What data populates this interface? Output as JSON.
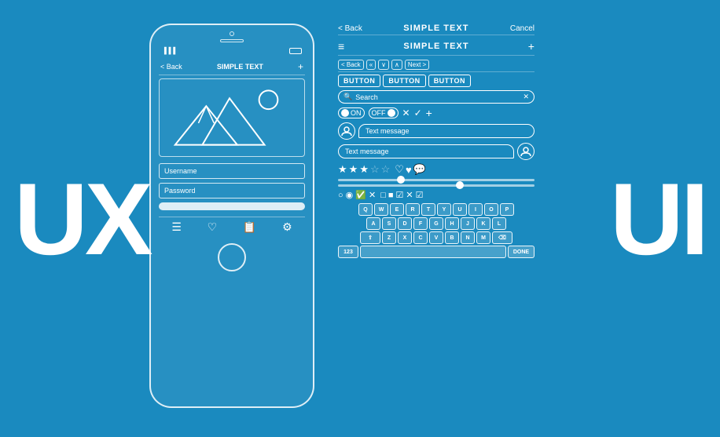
{
  "background": "#1a8abf",
  "ux_label": "UX",
  "ui_label": "UI",
  "phone": {
    "back_label": "< Back",
    "title": "SIMPLE TEXT",
    "plus_label": "+",
    "username_placeholder": "Username",
    "password_placeholder": "Password"
  },
  "ui_panel": {
    "row1": {
      "back": "< Back",
      "title": "SIMPLE TEXT",
      "cancel": "Cancel"
    },
    "row2": {
      "hamburger": "≡",
      "title": "SIMPLE TEXT",
      "plus": "+"
    },
    "row3": {
      "back": "< Back",
      "next": "Next >"
    },
    "buttons": [
      "BUTTON",
      "BUTTON",
      "BUTTON"
    ],
    "search_placeholder": "Search",
    "toggle_on": "ON",
    "toggle_off": "OFF",
    "chat_message1": "Text message",
    "chat_message2": "Text message",
    "keyboard": {
      "row1": [
        "Q",
        "W",
        "E",
        "R",
        "T",
        "Y",
        "U",
        "I",
        "O",
        "P"
      ],
      "row2": [
        "A",
        "S",
        "D",
        "F",
        "G",
        "H",
        "J",
        "K",
        "L"
      ],
      "row3": [
        "Z",
        "X",
        "C",
        "V",
        "B",
        "N",
        "M"
      ],
      "num_label": "123",
      "done_label": "DONE"
    }
  }
}
